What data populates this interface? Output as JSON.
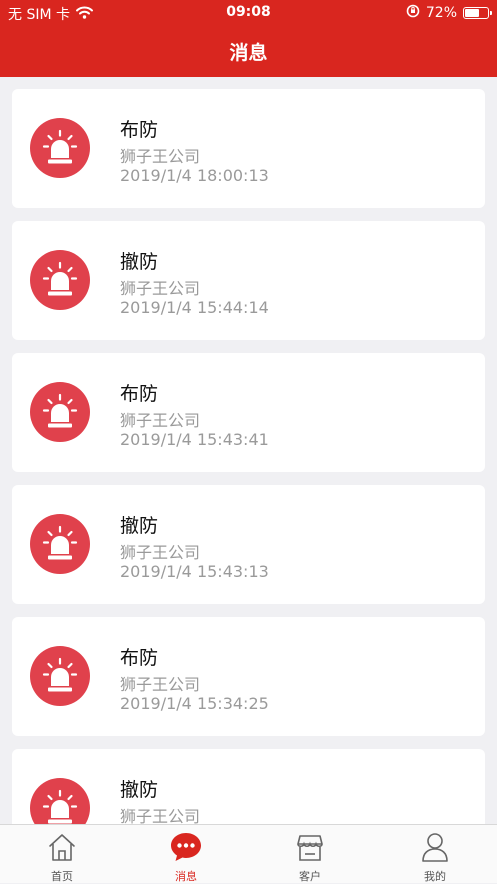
{
  "status_bar": {
    "carrier": "无 SIM 卡",
    "time": "09:08",
    "battery": "72%",
    "battery_level": 0.72
  },
  "header": {
    "title": "消息"
  },
  "messages": [
    {
      "title": "布防",
      "company": "狮子王公司",
      "time": "2019/1/4 18:00:13"
    },
    {
      "title": "撤防",
      "company": "狮子王公司",
      "time": "2019/1/4 15:44:14"
    },
    {
      "title": "布防",
      "company": "狮子王公司",
      "time": "2019/1/4 15:43:41"
    },
    {
      "title": "撤防",
      "company": "狮子王公司",
      "time": "2019/1/4 15:43:13"
    },
    {
      "title": "布防",
      "company": "狮子王公司",
      "time": "2019/1/4 15:34:25"
    },
    {
      "title": "撤防",
      "company": "狮子王公司",
      "time": ""
    }
  ],
  "tabbar": {
    "items": [
      {
        "label": "首页",
        "icon": "home-icon"
      },
      {
        "label": "消息",
        "icon": "chat-icon",
        "active": true
      },
      {
        "label": "客户",
        "icon": "store-icon"
      },
      {
        "label": "我的",
        "icon": "user-icon"
      }
    ]
  },
  "colors": {
    "brand": "#d9261f",
    "alarm": "#e0414c",
    "muted_text": "#9a9a9a"
  }
}
